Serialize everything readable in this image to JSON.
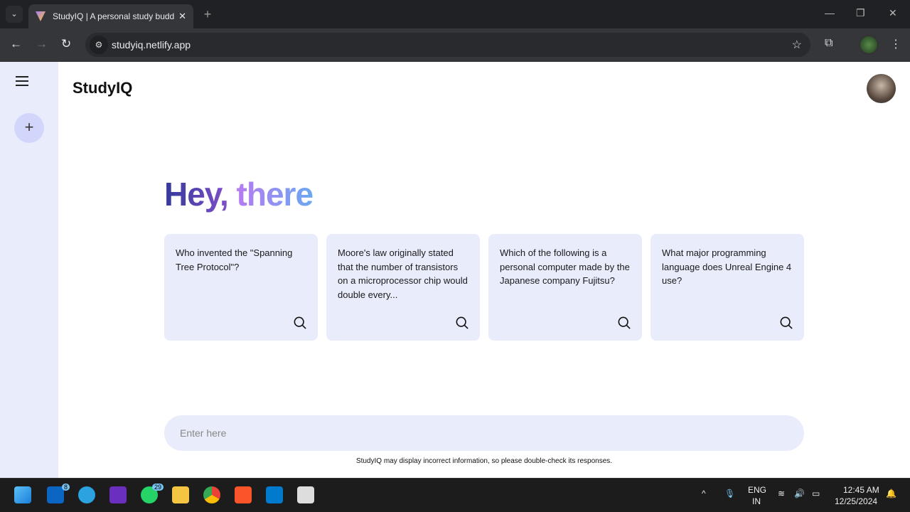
{
  "browser": {
    "tab_title": "StudyIQ | A personal study buddy",
    "url": "studyiq.netlify.app"
  },
  "app": {
    "name": "StudyIQ",
    "greeting_1": "Hey,",
    "greeting_2": "there",
    "cards": [
      {
        "text": "Who invented the \"Spanning Tree Protocol\"?"
      },
      {
        "text": "Moore's law originally stated that the number of transistors on a microprocessor chip would double every..."
      },
      {
        "text": "Which of the following is a personal computer made by the Japanese company Fujitsu?"
      },
      {
        "text": "What major programming language does Unreal Engine 4 use?"
      }
    ],
    "input_placeholder": "Enter here",
    "disclaimer": "StudyIQ may display incorrect information, so please double-check its responses."
  },
  "taskbar": {
    "linkedin_badge": "8",
    "whatsapp_badge": "29",
    "lang": "ENG",
    "region": "IN",
    "time": "12:45 AM",
    "date": "12/25/2024"
  }
}
